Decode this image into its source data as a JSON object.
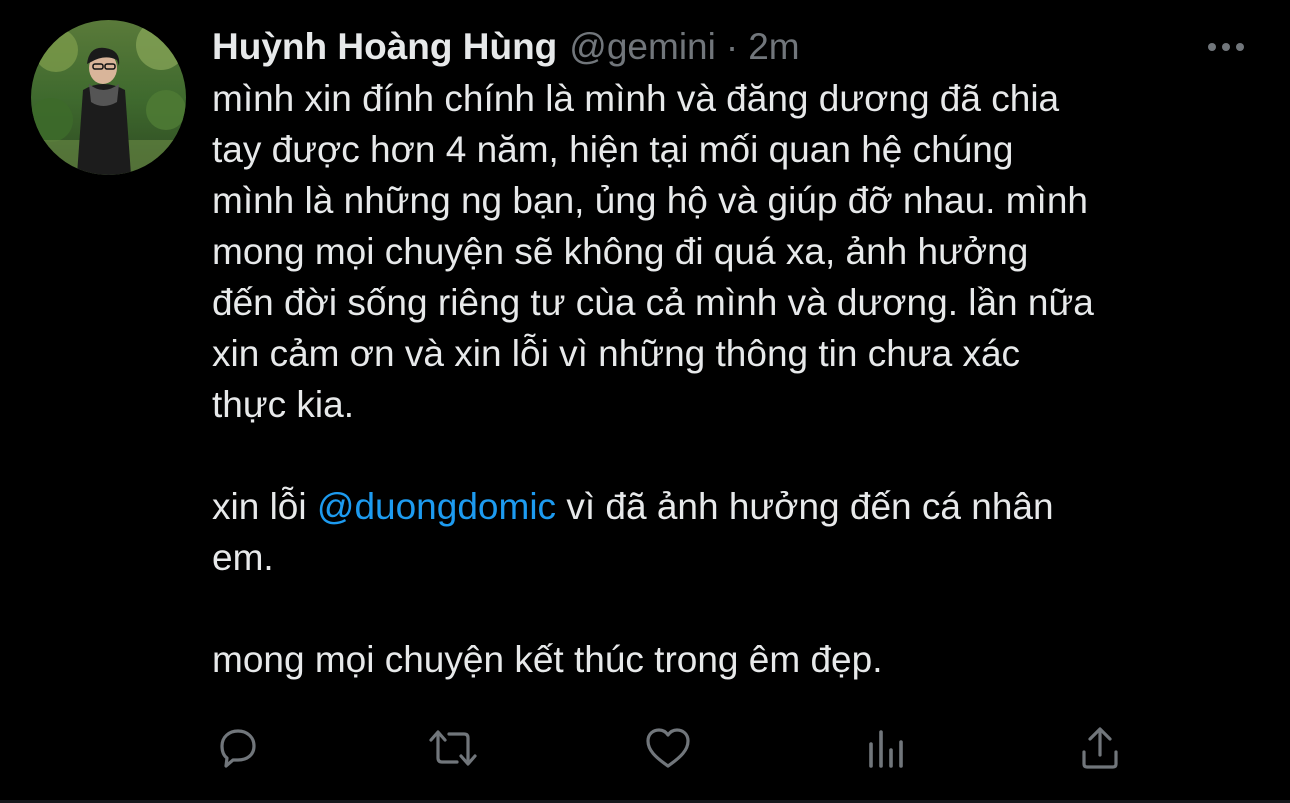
{
  "tweet": {
    "author": {
      "display_name": "Huỳnh Hoàng Hùng",
      "handle": "@gemini",
      "separator": "·",
      "time": "2m"
    },
    "more_icon": "more-horizontal-icon",
    "body": {
      "p1_lines": [
        "mình xin đính chính là mình và đăng dương đã chia",
        "tay được hơn 4 năm, hiện tại mối quan hệ chúng",
        "mình là những ng bạn, ủng hộ và giúp đỡ nhau. mình",
        "mong mọi chuyện sẽ không đi quá xa, ảnh hưởng",
        "đến đời sống riêng tư cùa cả mình và dương. lần nữa",
        "xin cảm ơn và xin lỗi vì những thông tin chưa xác",
        "thực kia."
      ],
      "p2_prefix": "xin lỗi ",
      "p2_mention": "@duongdomic",
      "p2_suffix": " vì đã ảnh hưởng đến cá nhân",
      "p2_line2": "em.",
      "p3": "mong mọi chuyện kết thúc trong êm đẹp."
    },
    "actions": [
      {
        "name": "reply",
        "icon": "reply-bubble-icon"
      },
      {
        "name": "retweet",
        "icon": "retweet-icon"
      },
      {
        "name": "like",
        "icon": "heart-icon"
      },
      {
        "name": "analytics",
        "icon": "analytics-bars-icon"
      },
      {
        "name": "share",
        "icon": "share-upload-icon"
      }
    ],
    "colors": {
      "background": "#000000",
      "text": "#e7e9ea",
      "muted": "#71767b",
      "mention": "#1d9bf0"
    }
  }
}
